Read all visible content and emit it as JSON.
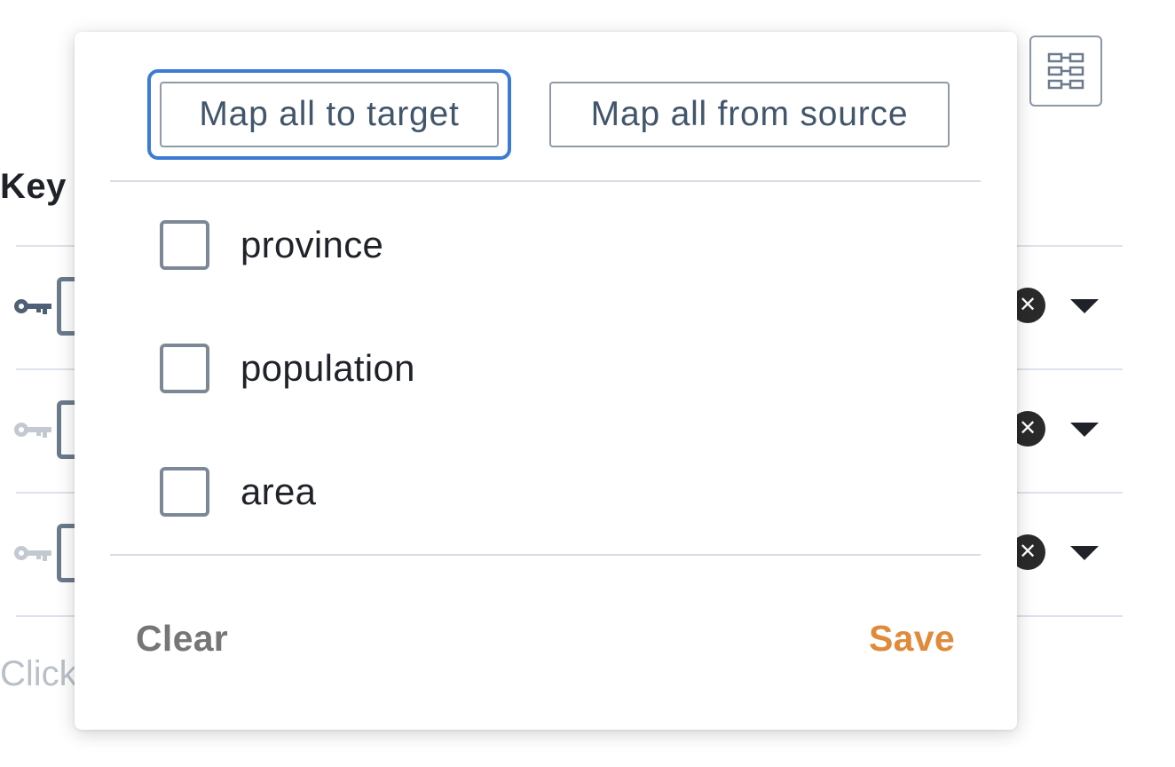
{
  "background": {
    "column_header": "Key",
    "hint_text": "Click",
    "rows": [
      {
        "key_style": "primary",
        "clear_glyph": "✕"
      },
      {
        "key_style": "muted",
        "clear_glyph": "✕"
      },
      {
        "key_style": "muted",
        "clear_glyph": "✕"
      }
    ],
    "icons": {
      "key": "key-icon",
      "clear": "clear-circle-icon",
      "caret": "caret-down-icon",
      "layout": "layout-grid-icon"
    }
  },
  "popover": {
    "map_all_to_target_label": "Map all to target",
    "map_all_from_source_label": "Map all from source",
    "options": [
      {
        "label": "province",
        "checked": false
      },
      {
        "label": "population",
        "checked": false
      },
      {
        "label": "area",
        "checked": false
      }
    ],
    "clear_label": "Clear",
    "save_label": "Save"
  },
  "colors": {
    "accent_save": "#e08a3c",
    "clear_text": "#767676",
    "button_text": "#41556b",
    "focus_ring": "#3b7bd4",
    "key_primary": "#4f6076",
    "key_muted": "#c3c9d0"
  }
}
